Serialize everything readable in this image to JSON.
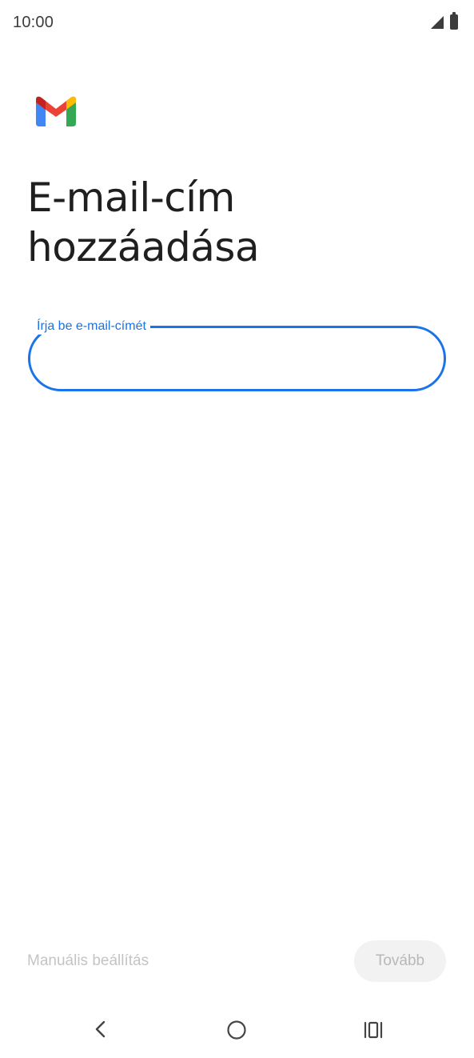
{
  "status_bar": {
    "time": "10:00",
    "icons": [
      "signal-icon",
      "battery-icon"
    ]
  },
  "logo": {
    "name": "gmail-logo",
    "colors": {
      "blue": "#4285f4",
      "red": "#ea4335",
      "yellow": "#fbbc04",
      "green": "#34a853",
      "dark_red": "#c5221f"
    }
  },
  "page": {
    "title_line1": "E-mail-cím",
    "title_line2": "hozzáadása"
  },
  "email_field": {
    "label": "Írja be e-mail-címét",
    "value": "",
    "accent_color": "#1a73e8"
  },
  "actions": {
    "manual_setup_label": "Manuális beállítás",
    "next_label": "Tovább"
  },
  "nav_bar": {
    "icons": [
      "back-icon",
      "home-icon",
      "recents-icon"
    ]
  }
}
